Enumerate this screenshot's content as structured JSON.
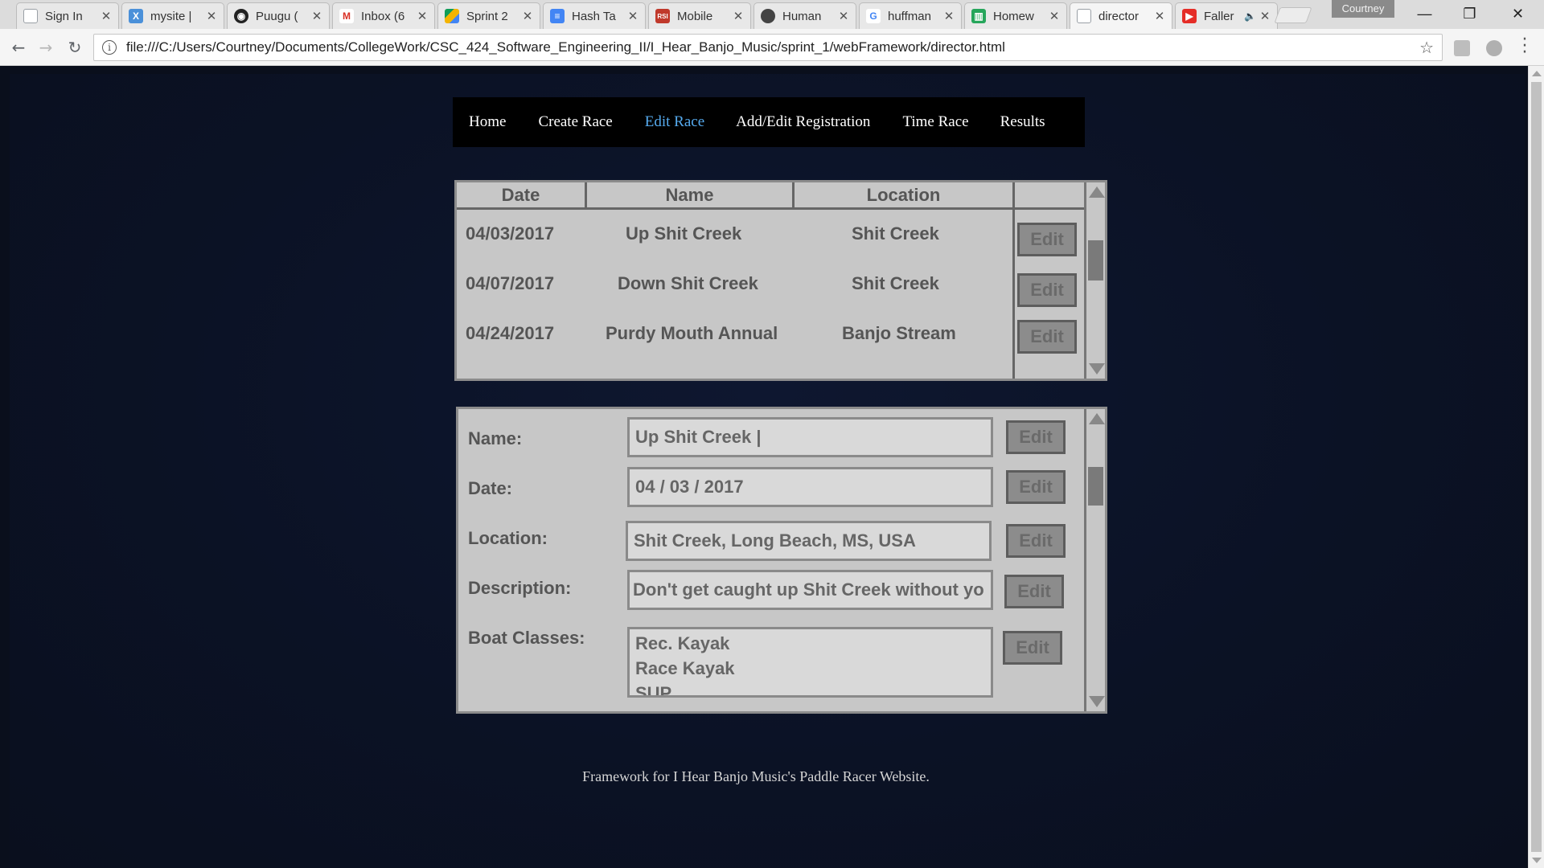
{
  "browser": {
    "tabs": [
      {
        "title": "Sign In",
        "icon": "document-icon",
        "color": "#9aa0a6"
      },
      {
        "title": "mysite |",
        "icon": "x-logo-icon",
        "color": "#4a90d9"
      },
      {
        "title": "Puugu (",
        "icon": "github-icon",
        "color": "#222222"
      },
      {
        "title": "Inbox (6",
        "icon": "gmail-icon",
        "color": "#d93025"
      },
      {
        "title": "Sprint 2",
        "icon": "drive-icon",
        "color": "#f4b400"
      },
      {
        "title": "Hash Ta",
        "icon": "docs-icon",
        "color": "#4285f4"
      },
      {
        "title": "Mobile",
        "icon": "rsi-icon",
        "color": "#c0392b"
      },
      {
        "title": "Human",
        "icon": "elephant-icon",
        "color": "#444444"
      },
      {
        "title": "huffman",
        "icon": "google-icon",
        "color": "#4285f4"
      },
      {
        "title": "Homew",
        "icon": "trello-icon",
        "color": "#26a65b"
      },
      {
        "title": "director",
        "icon": "document-icon",
        "color": "#9aa0a6"
      },
      {
        "title": "Faller",
        "icon": "youtube-icon",
        "color": "#e52d27"
      }
    ],
    "profile_name": "Courtney",
    "url": "file:///C:/Users/Courtney/Documents/CollegeWork/CSC_424_Software_Engineering_II/I_Hear_Banjo_Music/sprint_1/webFramework/director.html"
  },
  "nav": {
    "items": [
      "Home",
      "Create Race",
      "Edit Race",
      "Add/Edit Registration",
      "Time Race",
      "Results"
    ],
    "active": "Edit Race"
  },
  "races_table": {
    "headers": [
      "Date",
      "Name",
      "Location"
    ],
    "rows": [
      {
        "date": "04/03/2017",
        "name": "Up Shit Creek",
        "location": "Shit Creek",
        "action": "Edit"
      },
      {
        "date": "04/07/2017",
        "name": "Down Shit Creek",
        "location": "Shit Creek",
        "action": "Edit"
      },
      {
        "date": "04/24/2017",
        "name": "Purdy Mouth Annual",
        "location": "Banjo Stream",
        "action": "Edit"
      }
    ]
  },
  "race_details": {
    "fields": [
      {
        "label": "Name:",
        "value": "Up Shit Creek |",
        "action": "Edit"
      },
      {
        "label": "Date:",
        "value": "04 / 03 / 2017",
        "action": "Edit"
      },
      {
        "label": "Location:",
        "value": "Shit Creek, Long Beach, MS, USA",
        "action": "Edit"
      },
      {
        "label": "Description:",
        "value": "Don't get caught up Shit Creek without yo",
        "action": "Edit"
      },
      {
        "label": "Boat Classes:",
        "values": [
          "Rec. Kayak",
          "Race Kayak",
          "SUP"
        ],
        "action": "Edit"
      }
    ]
  },
  "footer": "Framework for I Hear Banjo Music's Paddle Racer Website.",
  "colors": {
    "page_bg": "#0b1225",
    "nav_bg": "#000000",
    "nav_active": "#55aaee",
    "panel_bg": "#c7c7c7",
    "button_bg": "#8c8c8c"
  }
}
